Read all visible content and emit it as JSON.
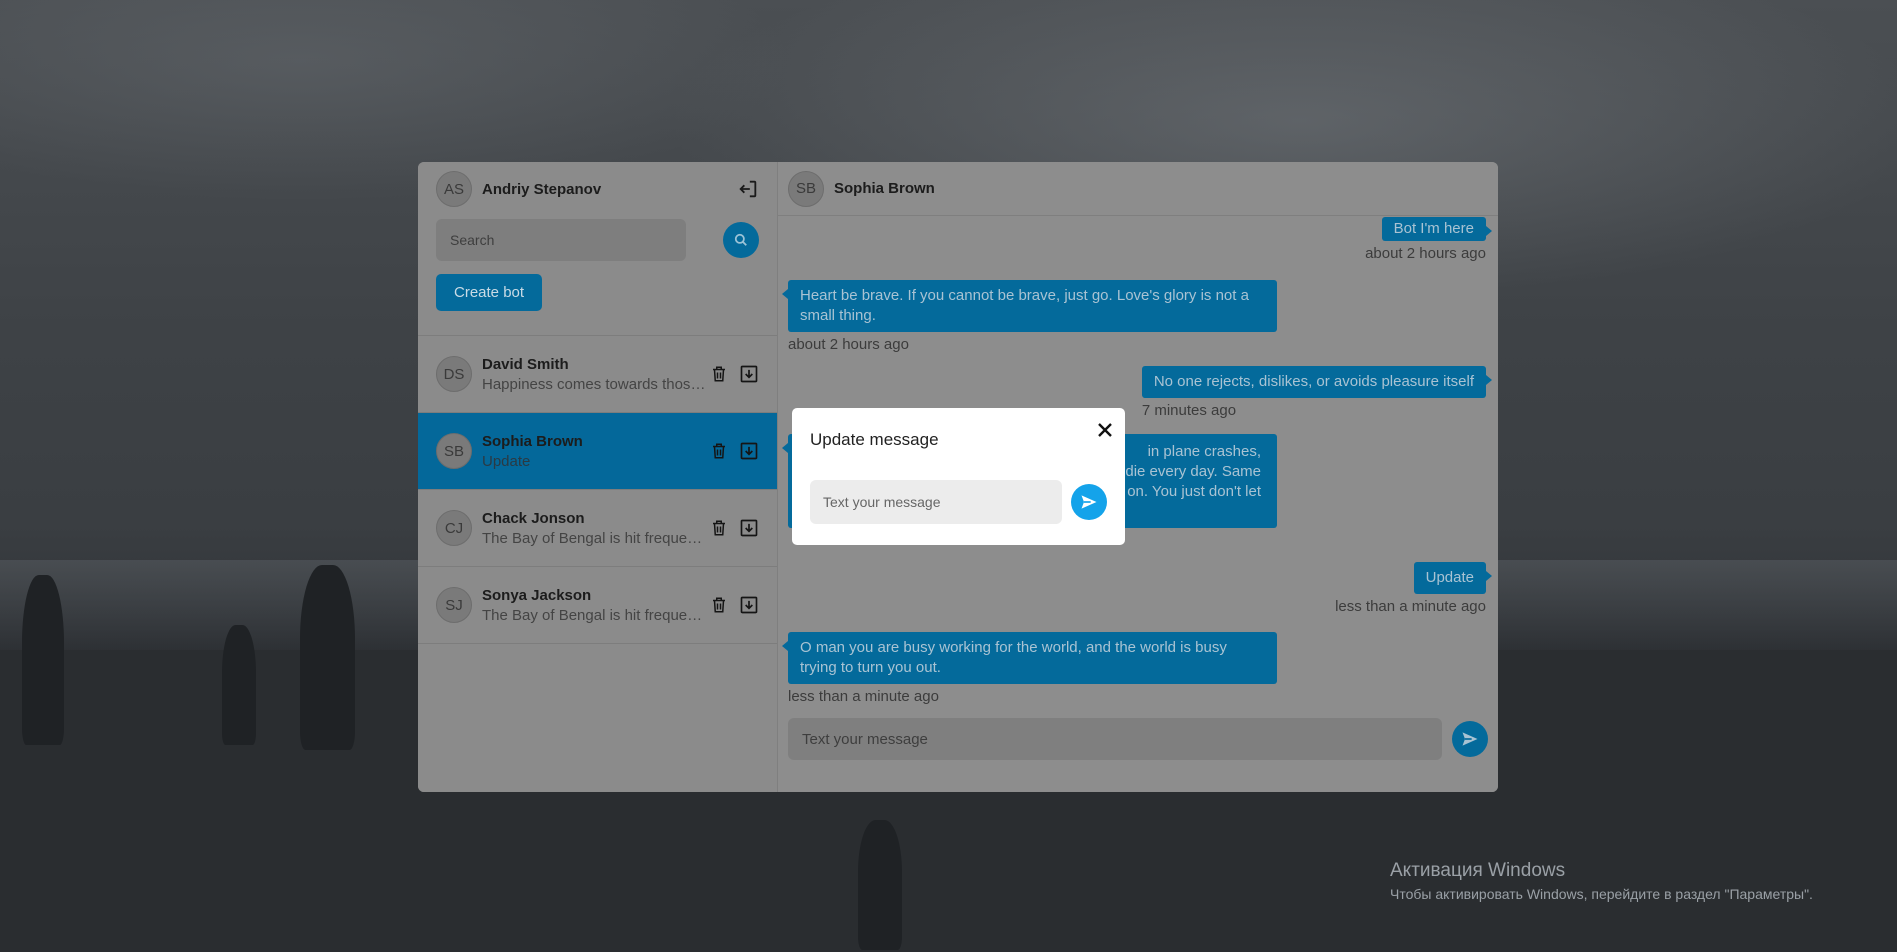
{
  "current_user": {
    "initials": "AS",
    "name": "Andriy Stepanov"
  },
  "search": {
    "placeholder": "Search"
  },
  "create_bot_label": "Create bot",
  "chats": [
    {
      "initials": "DS",
      "name": "David Smith",
      "preview": "Happiness comes towards those who…",
      "active": false
    },
    {
      "initials": "SB",
      "name": "Sophia Brown",
      "preview": "Update",
      "active": true
    },
    {
      "initials": "CJ",
      "name": "Chack Jonson",
      "preview": "The Bay of Bengal is hit frequently…",
      "active": false
    },
    {
      "initials": "SJ",
      "name": "Sonya Jackson",
      "preview": "The Bay of Bengal is hit frequently…",
      "active": false
    }
  ],
  "conversation": {
    "initials": "SB",
    "name": "Sophia Brown",
    "messages": [
      {
        "side": "right",
        "text": "Bot I'm here",
        "time": "about 2 hours ago"
      },
      {
        "side": "left",
        "text": "Heart be brave. If you cannot be brave, just go. Love's glory is not a small thing.",
        "time": "about 2 hours ago"
      },
      {
        "side": "right",
        "text": "No one rejects, dislikes, or avoids pleasure itself",
        "time": "7 minutes ago"
      },
      {
        "side": "left",
        "text_visible_fragments": [
          "in plane crashes,",
          "die every day. Same",
          "on. You just don't let"
        ],
        "time": ""
      },
      {
        "side": "right",
        "text": "Update",
        "time": "less than a minute ago"
      },
      {
        "side": "left",
        "text": "O man you are busy working for the world, and the world is busy trying to turn you out.",
        "time": "less than a minute ago"
      }
    ],
    "composer_placeholder": "Text your message"
  },
  "modal": {
    "title": "Update message",
    "input_placeholder": "Text your message"
  },
  "watermark": {
    "title": "Активация Windows",
    "subtitle": "Чтобы активировать Windows, перейдите в раздел \"Параметры\"."
  },
  "colors": {
    "accent": "#046a9b",
    "modal_send": "#14a3ea"
  },
  "icons": {
    "logout": "logout-icon",
    "search": "search-icon",
    "delete": "trash-icon",
    "download": "download-icon",
    "send": "send-icon",
    "close": "close-icon"
  }
}
